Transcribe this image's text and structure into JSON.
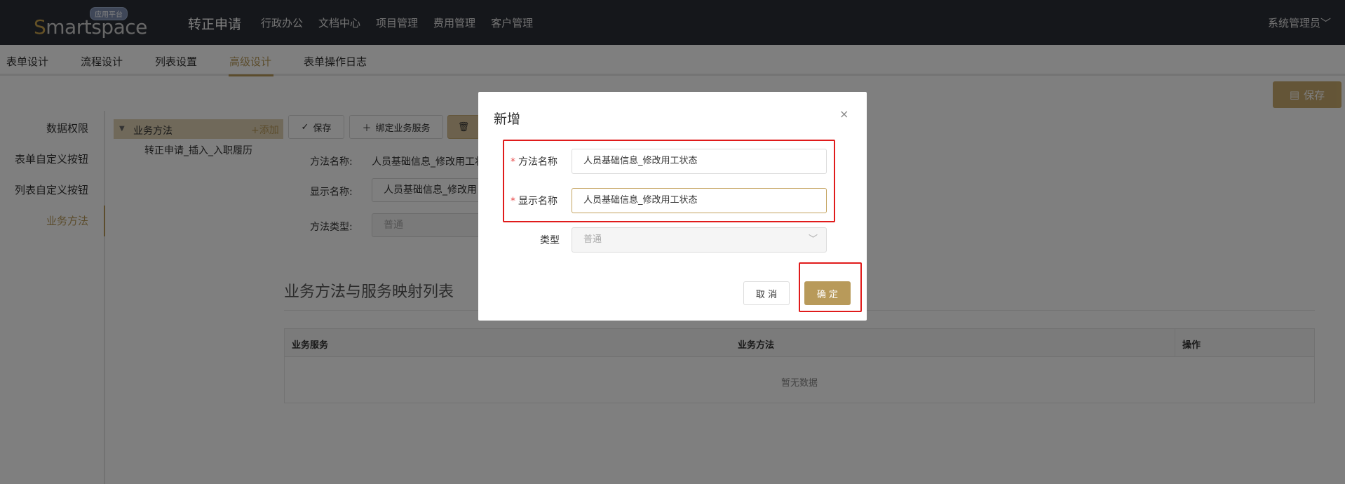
{
  "topbar": {
    "logo_text_s": "S",
    "logo_text_rest": "martspace",
    "logo_badge": "应用平台",
    "app_title": "转正申请",
    "nav": [
      "行政办公",
      "文档中心",
      "项目管理",
      "费用管理",
      "客户管理"
    ],
    "user": "系统管理员",
    "user_chevron": "﹀"
  },
  "tabs": [
    "表单设计",
    "流程设计",
    "列表设置",
    "高级设计",
    "表单操作日志"
  ],
  "active_tab": "高级设计",
  "page_save_label": "保存",
  "side_menu": {
    "items": [
      "数据权限",
      "表单自定义按钮",
      "列表自定义按钮",
      "业务方法"
    ],
    "active": "业务方法"
  },
  "tree": {
    "root_label": "业务方法",
    "add_label": "+添加",
    "child_label": "转正申请_插入_入职履历"
  },
  "toolbar": {
    "save": "保存",
    "bind": "绑定业务服务"
  },
  "form": {
    "method_name_label": "方法名称:",
    "method_name_value": "人员基础信息_修改用工状",
    "display_name_label": "显示名称:",
    "display_name_value": "人员基础信息_修改用",
    "method_type_label": "方法类型:",
    "method_type_value": "普通"
  },
  "section": {
    "title": "业务方法与服务映射列表",
    "columns": [
      "业务服务",
      "业务方法",
      "操作"
    ],
    "empty_text": "暂无数据"
  },
  "modal": {
    "title": "新增",
    "close": "×",
    "method_name_label": "方法名称",
    "method_name_value": "人员基础信息_修改用工状态",
    "display_name_label": "显示名称",
    "display_name_value": "人员基础信息_修改用工状态",
    "type_label": "类型",
    "type_value": "普通",
    "required_mark": "*",
    "cancel": "取 消",
    "ok": "确 定"
  },
  "colors": {
    "accent": "#b89a5a",
    "topbar": "#2b2e36",
    "highlight": "#e01b1b"
  }
}
